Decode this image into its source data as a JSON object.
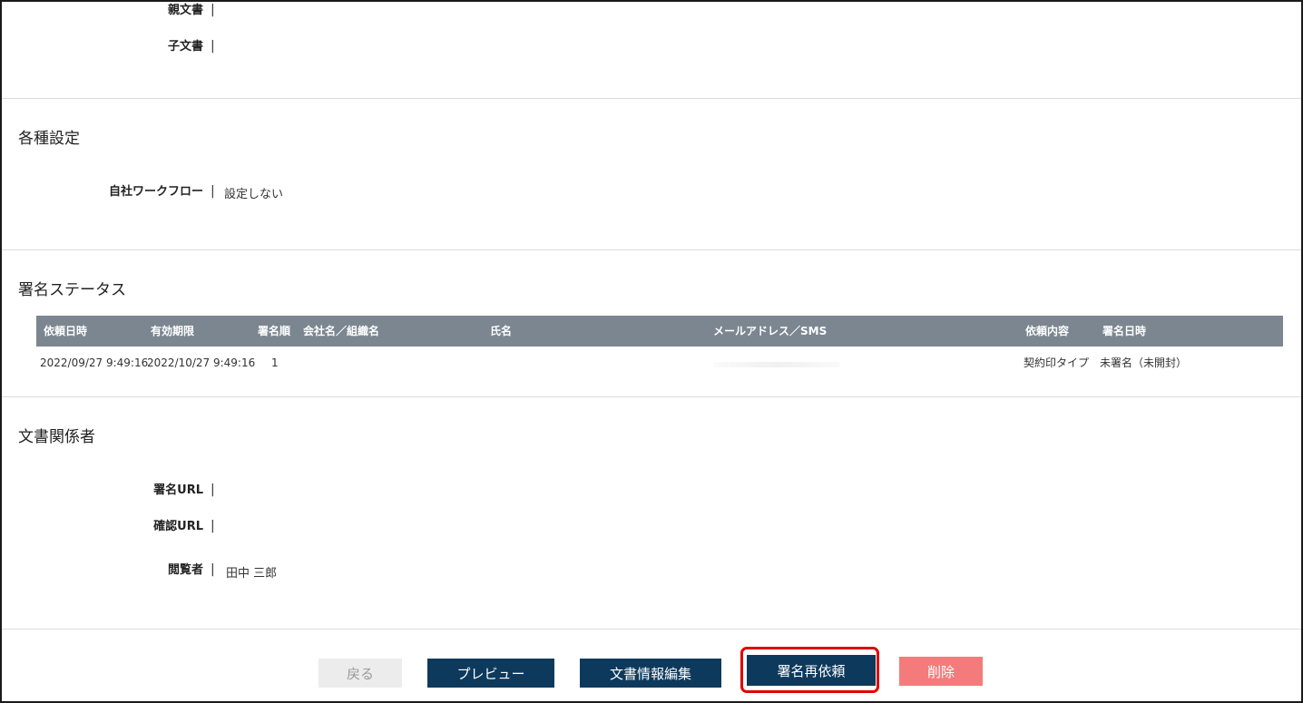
{
  "top_fields": {
    "parent_doc_label": "親文書",
    "child_doc_label": "子文書",
    "separator": "|"
  },
  "settings": {
    "title": "各種設定",
    "workflow_label": "自社ワークフロー",
    "workflow_value": "設定しない"
  },
  "signature_status": {
    "title": "署名ステータス",
    "columns": [
      "依頼日時",
      "有効期限",
      "署名順",
      "会社名／組織名",
      "氏名",
      "メールアドレス／SMS",
      "依頼内容",
      "署名日時"
    ],
    "rows": [
      {
        "request_datetime": "2022/09/27 9:49:16",
        "expiry": "2022/10/27 9:49:16",
        "order": "1",
        "company": "",
        "name": "",
        "email": "",
        "request_type": "契約印タイプ",
        "signed_datetime": "未署名（未開封）"
      }
    ]
  },
  "stakeholders": {
    "title": "文書関係者",
    "sign_url_label": "署名URL",
    "confirm_url_label": "確認URL",
    "viewer_label": "閲覧者",
    "viewer_value": "田中 三郎"
  },
  "actions": {
    "back": "戻る",
    "preview": "プレビュー",
    "edit_info": "文書情報編集",
    "resend_sign": "署名再依頼",
    "delete": "削除"
  },
  "colors": {
    "primary": "#0d3a5c",
    "table_header": "#7b8690",
    "delete": "#f37b7b",
    "disabled": "#ececec",
    "highlight": "#e00000"
  }
}
